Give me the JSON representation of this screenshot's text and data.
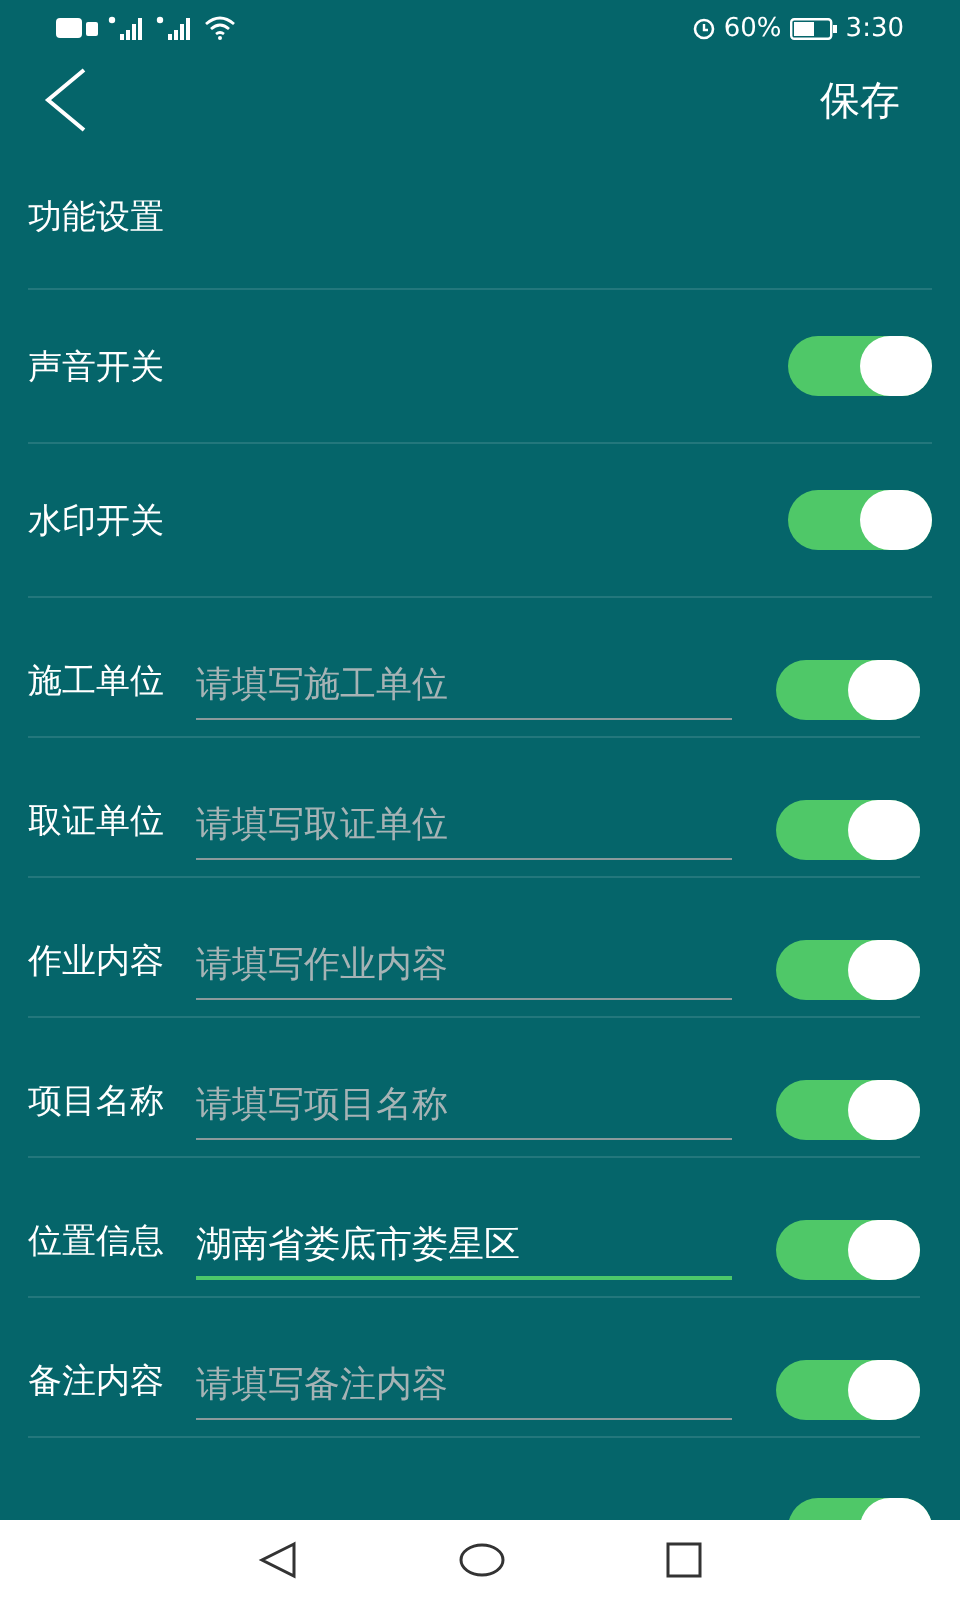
{
  "status_bar": {
    "battery": "60%",
    "time": "3:30"
  },
  "header": {
    "save": "保存"
  },
  "section_title": "功能设置",
  "rows": [
    {
      "kind": "toggle",
      "label": "声音开关",
      "on": true
    },
    {
      "kind": "toggle",
      "label": "水印开关",
      "on": true
    },
    {
      "kind": "field",
      "label": "施工单位",
      "placeholder": "请填写施工单位",
      "on": true,
      "focused": false
    },
    {
      "kind": "field",
      "label": "取证单位",
      "placeholder": "请填写取证单位",
      "on": true,
      "focused": false
    },
    {
      "kind": "field",
      "label": "作业内容",
      "placeholder": "请填写作业内容",
      "on": true,
      "focused": false
    },
    {
      "kind": "field",
      "label": "项目名称",
      "placeholder": "请填写项目名称",
      "on": true,
      "focused": false
    },
    {
      "kind": "field",
      "label": "位置信息",
      "value": "湖南省娄底市娄星区",
      "on": true,
      "focused": true
    },
    {
      "kind": "field",
      "label": "备注内容",
      "placeholder": "请填写备注内容",
      "on": true,
      "focused": false
    },
    {
      "kind": "cut",
      "on": true
    }
  ]
}
